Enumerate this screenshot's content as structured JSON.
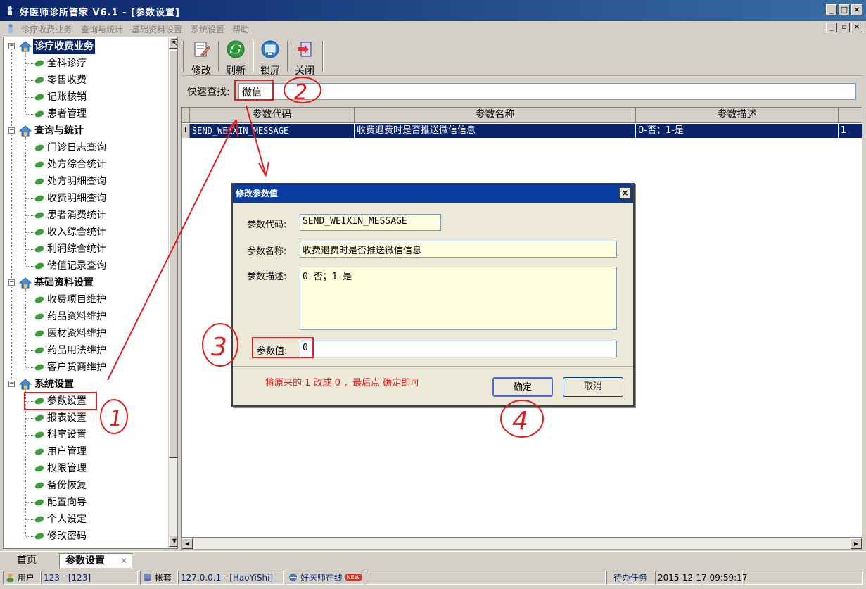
{
  "window": {
    "title": "好医师诊所管家 V6.1 - [参数设置]",
    "buttons": {
      "minimize": "_",
      "maximize": "□",
      "close": "×"
    },
    "mdi_buttons": {
      "minimize": "_",
      "restore": "▫",
      "close": "×"
    }
  },
  "menu": [
    "诊疗收费业务",
    "查询与统计",
    "基础资料设置",
    "系统设置",
    "帮助"
  ],
  "sidebar": {
    "groups": [
      {
        "label": "诊疗收费业务",
        "expander": "−",
        "items": [
          "全科诊疗",
          "零售收费",
          "记账核销",
          "患者管理"
        ]
      },
      {
        "label": "查询与统计",
        "expander": "−",
        "items": [
          "门诊日志查询",
          "处方综合统计",
          "处方明细查询",
          "收费明细查询",
          "患者消费统计",
          "收入综合统计",
          "利润综合统计",
          "储值记录查询"
        ]
      },
      {
        "label": "基础资料设置",
        "expander": "−",
        "items": [
          "收费项目维护",
          "药品资料维护",
          "医材资料维护",
          "药品用法维护",
          "客户货商维护"
        ]
      },
      {
        "label": "系统设置",
        "expander": "−",
        "items": [
          "参数设置",
          "报表设置",
          "科室设置",
          "用户管理",
          "权限管理",
          "备份恢复",
          "配置向导",
          "个人设定",
          "修改密码"
        ]
      }
    ],
    "pin_glyph": "⇱",
    "scroll_up": "▲",
    "scroll_down": "▼"
  },
  "toolbar": {
    "edit": "修改",
    "refresh": "刷新",
    "lock": "锁屏",
    "close": "关闭"
  },
  "search": {
    "label": "快速查找:",
    "value": "微信"
  },
  "grid": {
    "columns": [
      "参数代码",
      "参数名称",
      "参数描述"
    ],
    "row_indicator": "I",
    "rows": [
      {
        "code": "SEND_WEIXIN_MESSAGE",
        "name": "收费退费时是否推送微信信息",
        "desc": "0-否；1-是",
        "value": "1"
      }
    ],
    "scroll_left": "◀",
    "scroll_right": "▶"
  },
  "tabs": {
    "home": "首页",
    "current": "参数设置",
    "close_glyph": "✕"
  },
  "status": {
    "user_label": "用户",
    "user_value": "123 - [123]",
    "account_label": "帐套",
    "account_value": "127.0.0.1 - [HaoYiShi]",
    "online": "好医师在线",
    "new_badge": "NEW",
    "tasks": "待办任务",
    "datetime": "2015-12-17 09:59:17"
  },
  "dialog": {
    "title": "修改参数值",
    "close": "×",
    "code_label": "参数代码:",
    "code_value": "SEND_WEIXIN_MESSAGE",
    "name_label": "参数名称:",
    "name_value": "收费退费时是否推送微信信息",
    "desc_label": "参数描述:",
    "desc_value": "0-否；1-是",
    "value_label": "参数值:",
    "value_value": "0",
    "note": "将原来的 1 改成 0 ，最后点 确定即可",
    "ok": "确定",
    "cancel": "取消"
  },
  "annotations": {
    "one": "1",
    "two": "2",
    "three": "3",
    "four": "4"
  },
  "colors": {
    "accent": "#0a246a",
    "annotation_red": "#e02020"
  }
}
